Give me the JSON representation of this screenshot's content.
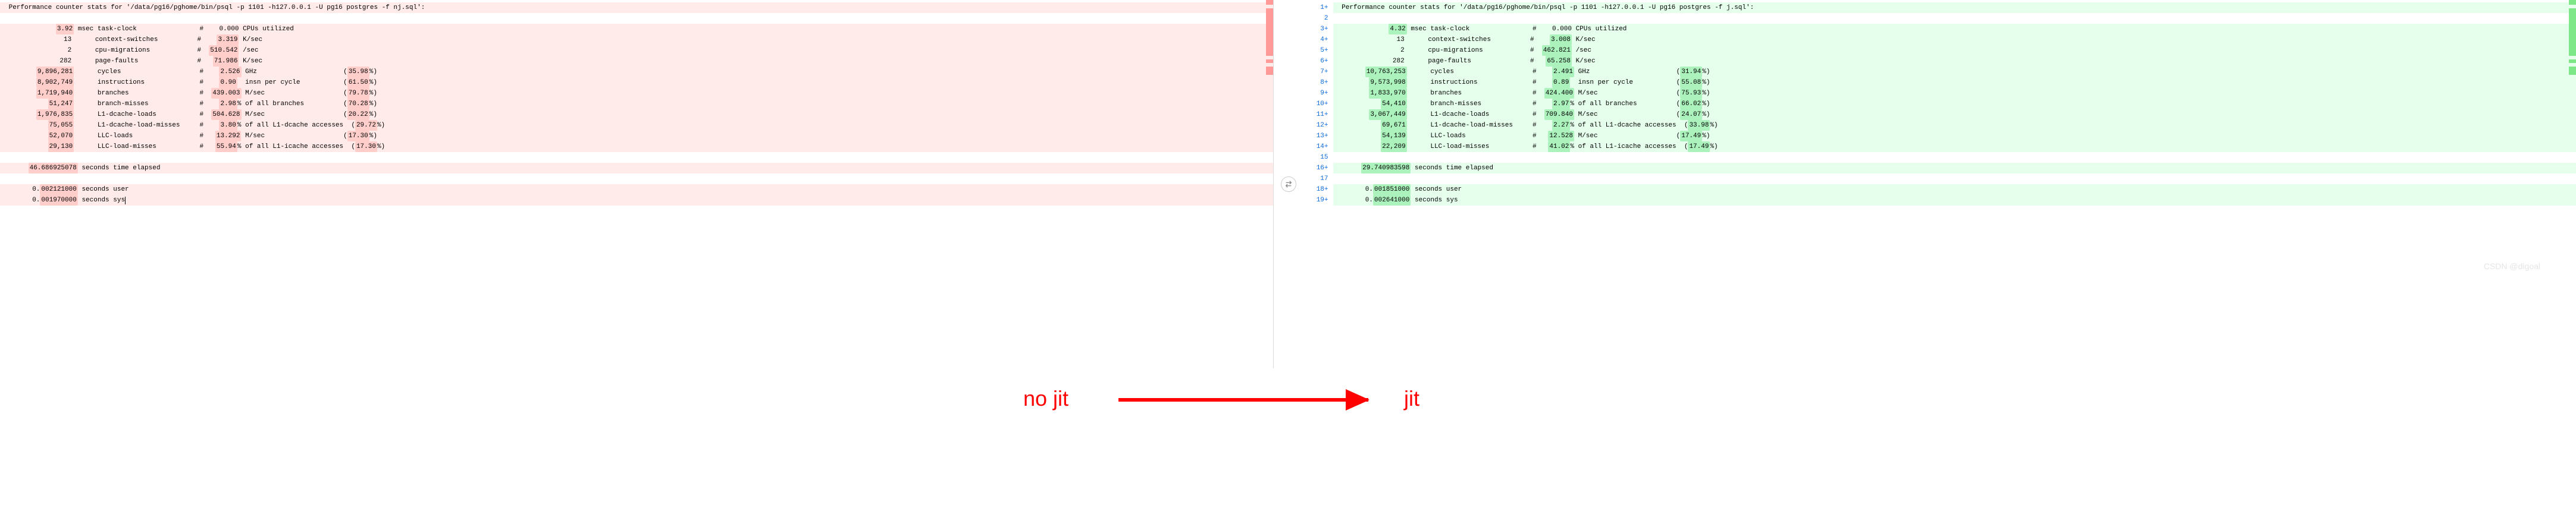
{
  "left": {
    "title": " Performance counter stats for '/data/pg16/pghome/bin/psql -p 1101 -h127.0.0.1 -U pg16 postgres -f nj.sql':",
    "lines": [
      {
        "type": "removed",
        "text": " Performance counter stats for '/data/pg16/pghome/bin/psql -p 1101 -h127.0.0.1 -U pg16 postgres -f nj.sql':"
      },
      {
        "type": "blank",
        "text": ""
      },
      {
        "type": "removed",
        "chunks": [
          {
            "t": "             "
          },
          {
            "t": "3.92",
            "hl": true
          },
          {
            "t": " msec task-clock                #    0.000 CPUs utilized"
          }
        ]
      },
      {
        "type": "removed",
        "chunks": [
          {
            "t": "               13      context-switches          #    "
          },
          {
            "t": "3.319",
            "hl": true
          },
          {
            "t": " K/sec"
          }
        ]
      },
      {
        "type": "removed",
        "chunks": [
          {
            "t": "                2      cpu-migrations            #  "
          },
          {
            "t": "510.542",
            "hl": true
          },
          {
            "t": " /sec"
          }
        ]
      },
      {
        "type": "removed",
        "chunks": [
          {
            "t": "              282      page-faults               #   "
          },
          {
            "t": "71.986",
            "hl": true
          },
          {
            "t": " K/sec"
          }
        ]
      },
      {
        "type": "removed",
        "chunks": [
          {
            "t": "        "
          },
          {
            "t": "9,896,281",
            "hl": true
          },
          {
            "t": "      cycles                    #    "
          },
          {
            "t": "2.526",
            "hl": true
          },
          {
            "t": " GHz                      ("
          },
          {
            "t": "35.98",
            "hl": true
          },
          {
            "t": "%)"
          }
        ]
      },
      {
        "type": "removed",
        "chunks": [
          {
            "t": "        "
          },
          {
            "t": "8,902,749",
            "hl": true
          },
          {
            "t": "      instructions              #    "
          },
          {
            "t": "0.90",
            "hl": true
          },
          {
            "t": "  insn per cycle           ("
          },
          {
            "t": "61.50",
            "hl": true
          },
          {
            "t": "%)"
          }
        ]
      },
      {
        "type": "removed",
        "chunks": [
          {
            "t": "        "
          },
          {
            "t": "1,719,940",
            "hl": true
          },
          {
            "t": "      branches                  #  "
          },
          {
            "t": "439.003",
            "hl": true
          },
          {
            "t": " M/sec                    ("
          },
          {
            "t": "79.78",
            "hl": true
          },
          {
            "t": "%)"
          }
        ]
      },
      {
        "type": "removed",
        "chunks": [
          {
            "t": "           "
          },
          {
            "t": "51,247",
            "hl": true
          },
          {
            "t": "      branch-misses             #    "
          },
          {
            "t": "2.98",
            "hl": true
          },
          {
            "t": "% of all branches          ("
          },
          {
            "t": "70.28",
            "hl": true
          },
          {
            "t": "%)"
          }
        ]
      },
      {
        "type": "removed",
        "chunks": [
          {
            "t": "        "
          },
          {
            "t": "1,976,835",
            "hl": true
          },
          {
            "t": "      L1-dcache-loads           #  "
          },
          {
            "t": "504.628",
            "hl": true
          },
          {
            "t": " M/sec                    ("
          },
          {
            "t": "20.22",
            "hl": true
          },
          {
            "t": "%)"
          }
        ]
      },
      {
        "type": "removed",
        "chunks": [
          {
            "t": "           "
          },
          {
            "t": "75,055",
            "hl": true
          },
          {
            "t": "      L1-dcache-load-misses     #    "
          },
          {
            "t": "3.80",
            "hl": true
          },
          {
            "t": "% of all L1-dcache accesses  ("
          },
          {
            "t": "29.72",
            "hl": true
          },
          {
            "t": "%)"
          }
        ]
      },
      {
        "type": "removed",
        "chunks": [
          {
            "t": "           "
          },
          {
            "t": "52,070",
            "hl": true
          },
          {
            "t": "      LLC-loads                 #   "
          },
          {
            "t": "13.292",
            "hl": true
          },
          {
            "t": " M/sec                    ("
          },
          {
            "t": "17.30",
            "hl": true
          },
          {
            "t": "%)"
          }
        ]
      },
      {
        "type": "removed",
        "chunks": [
          {
            "t": "           "
          },
          {
            "t": "29,130",
            "hl": true
          },
          {
            "t": "      LLC-load-misses           #   "
          },
          {
            "t": "55.94",
            "hl": true
          },
          {
            "t": "% of all L1-icache accesses  ("
          },
          {
            "t": "17.30",
            "hl": true
          },
          {
            "t": "%)"
          }
        ]
      },
      {
        "type": "blank",
        "text": ""
      },
      {
        "type": "removed",
        "chunks": [
          {
            "t": "      "
          },
          {
            "t": "46.686925078",
            "hl": true
          },
          {
            "t": " seconds time elapsed"
          }
        ]
      },
      {
        "type": "blank",
        "text": ""
      },
      {
        "type": "removed",
        "chunks": [
          {
            "t": "       0."
          },
          {
            "t": "002121000",
            "hl": true
          },
          {
            "t": " seconds user"
          }
        ]
      },
      {
        "type": "removed",
        "chunks": [
          {
            "t": "       0."
          },
          {
            "t": "001970000",
            "hl": true
          },
          {
            "t": " seconds sys"
          },
          {
            "cursor": true
          }
        ]
      }
    ]
  },
  "right": {
    "lines": [
      {
        "num": "1",
        "plus": "+",
        "type": "added",
        "text": " Performance counter stats for '/data/pg16/pghome/bin/psql -p 1101 -h127.0.0.1 -U pg16 postgres -f j.sql':"
      },
      {
        "num": "2",
        "plus": "",
        "type": "blank",
        "text": ""
      },
      {
        "num": "3",
        "plus": "+",
        "type": "added",
        "chunks": [
          {
            "t": "             "
          },
          {
            "t": "4.32",
            "hl": true
          },
          {
            "t": " msec task-clock                #    0.000 CPUs utilized"
          }
        ]
      },
      {
        "num": "4",
        "plus": "+",
        "type": "added",
        "chunks": [
          {
            "t": "               13      context-switches          #    "
          },
          {
            "t": "3.008",
            "hl": true
          },
          {
            "t": " K/sec"
          }
        ]
      },
      {
        "num": "5",
        "plus": "+",
        "type": "added",
        "chunks": [
          {
            "t": "                2      cpu-migrations            #  "
          },
          {
            "t": "462.821",
            "hl": true
          },
          {
            "t": " /sec"
          }
        ]
      },
      {
        "num": "6",
        "plus": "+",
        "type": "added",
        "chunks": [
          {
            "t": "              282      page-faults               #   "
          },
          {
            "t": "65.258",
            "hl": true
          },
          {
            "t": " K/sec"
          }
        ]
      },
      {
        "num": "7",
        "plus": "+",
        "type": "added",
        "chunks": [
          {
            "t": "       "
          },
          {
            "t": "10,763,253",
            "hl": true
          },
          {
            "t": "      cycles                    #    "
          },
          {
            "t": "2.491",
            "hl": true
          },
          {
            "t": " GHz                      ("
          },
          {
            "t": "31.94",
            "hl": true
          },
          {
            "t": "%)"
          }
        ]
      },
      {
        "num": "8",
        "plus": "+",
        "type": "added",
        "chunks": [
          {
            "t": "        "
          },
          {
            "t": "9,573,998",
            "hl": true
          },
          {
            "t": "      instructions              #    "
          },
          {
            "t": "0.89",
            "hl": true
          },
          {
            "t": "  insn per cycle           ("
          },
          {
            "t": "55.08",
            "hl": true
          },
          {
            "t": "%)"
          }
        ]
      },
      {
        "num": "9",
        "plus": "+",
        "type": "added",
        "chunks": [
          {
            "t": "        "
          },
          {
            "t": "1,833,970",
            "hl": true
          },
          {
            "t": "      branches                  #  "
          },
          {
            "t": "424.400",
            "hl": true
          },
          {
            "t": " M/sec                    ("
          },
          {
            "t": "75.93",
            "hl": true
          },
          {
            "t": "%)"
          }
        ]
      },
      {
        "num": "10",
        "plus": "+",
        "type": "added",
        "chunks": [
          {
            "t": "           "
          },
          {
            "t": "54,410",
            "hl": true
          },
          {
            "t": "      branch-misses             #    "
          },
          {
            "t": "2.97",
            "hl": true
          },
          {
            "t": "% of all branches          ("
          },
          {
            "t": "66.02",
            "hl": true
          },
          {
            "t": "%)"
          }
        ]
      },
      {
        "num": "11",
        "plus": "+",
        "type": "added",
        "chunks": [
          {
            "t": "        "
          },
          {
            "t": "3,067,449",
            "hl": true
          },
          {
            "t": "      L1-dcache-loads           #  "
          },
          {
            "t": "709.840",
            "hl": true
          },
          {
            "t": " M/sec                    ("
          },
          {
            "t": "24.07",
            "hl": true
          },
          {
            "t": "%)"
          }
        ]
      },
      {
        "num": "12",
        "plus": "+",
        "type": "added",
        "chunks": [
          {
            "t": "           "
          },
          {
            "t": "69,671",
            "hl": true
          },
          {
            "t": "      L1-dcache-load-misses     #    "
          },
          {
            "t": "2.27",
            "hl": true
          },
          {
            "t": "% of all L1-dcache accesses  ("
          },
          {
            "t": "33.98",
            "hl": true
          },
          {
            "t": "%)"
          }
        ]
      },
      {
        "num": "13",
        "plus": "+",
        "type": "added",
        "chunks": [
          {
            "t": "           "
          },
          {
            "t": "54,139",
            "hl": true
          },
          {
            "t": "      LLC-loads                 #   "
          },
          {
            "t": "12.528",
            "hl": true
          },
          {
            "t": " M/sec                    ("
          },
          {
            "t": "17.49",
            "hl": true
          },
          {
            "t": "%)"
          }
        ]
      },
      {
        "num": "14",
        "plus": "+",
        "type": "added",
        "chunks": [
          {
            "t": "           "
          },
          {
            "t": "22,209",
            "hl": true
          },
          {
            "t": "      LLC-load-misses           #   "
          },
          {
            "t": "41.02",
            "hl": true
          },
          {
            "t": "% of all L1-icache accesses  ("
          },
          {
            "t": "17.49",
            "hl": true
          },
          {
            "t": "%)"
          }
        ]
      },
      {
        "num": "15",
        "plus": "",
        "type": "blank",
        "text": ""
      },
      {
        "num": "16",
        "plus": "+",
        "type": "added",
        "chunks": [
          {
            "t": "      "
          },
          {
            "t": "29.740983598",
            "hl": true
          },
          {
            "t": " seconds time elapsed"
          }
        ]
      },
      {
        "num": "17",
        "plus": "",
        "type": "blank",
        "text": ""
      },
      {
        "num": "18",
        "plus": "+",
        "type": "added",
        "chunks": [
          {
            "t": "       0."
          },
          {
            "t": "001851000",
            "hl": true
          },
          {
            "t": " seconds user"
          }
        ]
      },
      {
        "num": "19",
        "plus": "+",
        "type": "added",
        "chunks": [
          {
            "t": "       0."
          },
          {
            "t": "002641000",
            "hl": true
          },
          {
            "t": " seconds sys"
          }
        ]
      }
    ]
  },
  "annotation": {
    "no_jit": "no jit",
    "jit": "jit"
  },
  "watermark": "CSDN @digoal"
}
